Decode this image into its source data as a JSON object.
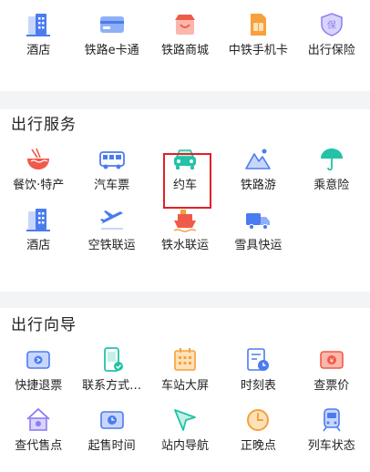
{
  "featured": {
    "items": [
      {
        "label": "酒店",
        "icon": "hotel-building-icon"
      },
      {
        "label": "铁路e卡通",
        "icon": "rail-ecard-icon"
      },
      {
        "label": "铁路商城",
        "icon": "shopping-store-icon"
      },
      {
        "label": "中铁手机卡",
        "icon": "sim-card-icon"
      },
      {
        "label": "出行保险",
        "icon": "insurance-shield-icon"
      }
    ]
  },
  "travel_services": {
    "title": "出行服务",
    "items": [
      {
        "label": "餐饮·特产",
        "icon": "noodle-bowl-icon"
      },
      {
        "label": "汽车票",
        "icon": "bus-icon"
      },
      {
        "label": "约车",
        "icon": "car-icon"
      },
      {
        "label": "铁路游",
        "icon": "mountain-icon"
      },
      {
        "label": "乘意险",
        "icon": "umbrella-icon"
      },
      {
        "label": "酒店",
        "icon": "hotel-building-icon"
      },
      {
        "label": "空铁联运",
        "icon": "plane-icon"
      },
      {
        "label": "铁水联运",
        "icon": "ship-icon"
      },
      {
        "label": "雪具快运",
        "icon": "delivery-truck-icon"
      }
    ]
  },
  "travel_guide": {
    "title": "出行向导",
    "items": [
      {
        "label": "快捷退票",
        "icon": "refund-ticket-icon"
      },
      {
        "label": "联系方式…",
        "icon": "phone-contact-icon"
      },
      {
        "label": "车站大屏",
        "icon": "station-screen-icon"
      },
      {
        "label": "时刻表",
        "icon": "timetable-icon"
      },
      {
        "label": "查票价",
        "icon": "ticket-price-icon"
      },
      {
        "label": "查代售点",
        "icon": "agency-home-icon"
      },
      {
        "label": "起售时间",
        "icon": "sale-time-ticket-icon"
      },
      {
        "label": "站内导航",
        "icon": "navigation-arrow-icon"
      },
      {
        "label": "正晚点",
        "icon": "clock-icon"
      },
      {
        "label": "列车状态",
        "icon": "train-icon"
      }
    ]
  },
  "colors": {
    "blue": "#4a7cf0",
    "orange": "#f7a03c",
    "red": "#f05a4a",
    "teal": "#22c3a6",
    "purple": "#8a7ef0",
    "highlight": "#e0202a"
  }
}
